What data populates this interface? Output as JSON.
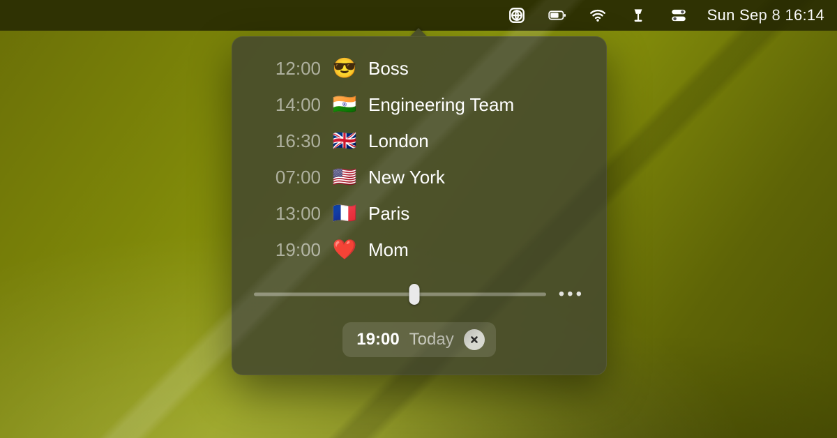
{
  "menubar": {
    "datetime": "Sun Sep 8  16:14"
  },
  "popover": {
    "items": [
      {
        "time": "12:00",
        "icon": "😎",
        "label": "Boss"
      },
      {
        "time": "14:00",
        "icon": "🇮🇳",
        "label": "Engineering Team"
      },
      {
        "time": "16:30",
        "icon": "🇬🇧",
        "label": "London"
      },
      {
        "time": "07:00",
        "icon": "🇺🇸",
        "label": "New York"
      },
      {
        "time": "13:00",
        "icon": "🇫🇷",
        "label": "Paris"
      },
      {
        "time": "19:00",
        "icon": "❤️",
        "label": "Mom"
      }
    ],
    "selected": {
      "time": "19:00",
      "day": "Today"
    }
  }
}
